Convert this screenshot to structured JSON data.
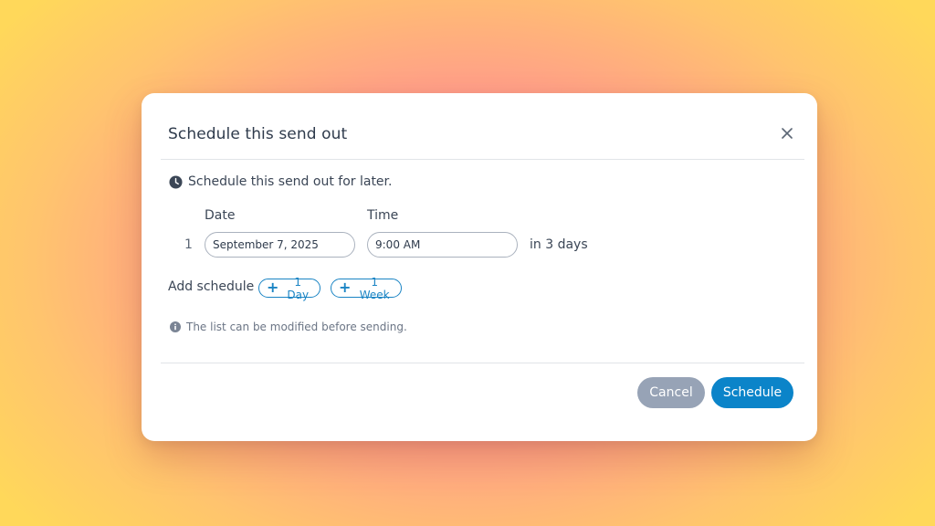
{
  "dialog": {
    "title": "Schedule this send out",
    "close_icon": "close-icon"
  },
  "intro": {
    "icon": "clock-icon",
    "text": "Schedule this send out for later."
  },
  "schedule": {
    "date_label": "Date",
    "time_label": "Time",
    "rows": [
      {
        "index": "1",
        "date_value": "September 7, 2025",
        "time_value": "9:00 AM",
        "relative": "in 3 days"
      }
    ]
  },
  "add_schedule": {
    "label": "Add schedule",
    "options": [
      {
        "label": "1 Day"
      },
      {
        "label": "1 Week"
      }
    ]
  },
  "note": {
    "icon": "info-icon",
    "text": "The list can be modified before sending."
  },
  "footer": {
    "cancel_label": "Cancel",
    "schedule_label": "Schedule"
  },
  "colors": {
    "primary": "#0b84c9",
    "secondary": "#97a3b6",
    "text": "#2f3b4c"
  }
}
